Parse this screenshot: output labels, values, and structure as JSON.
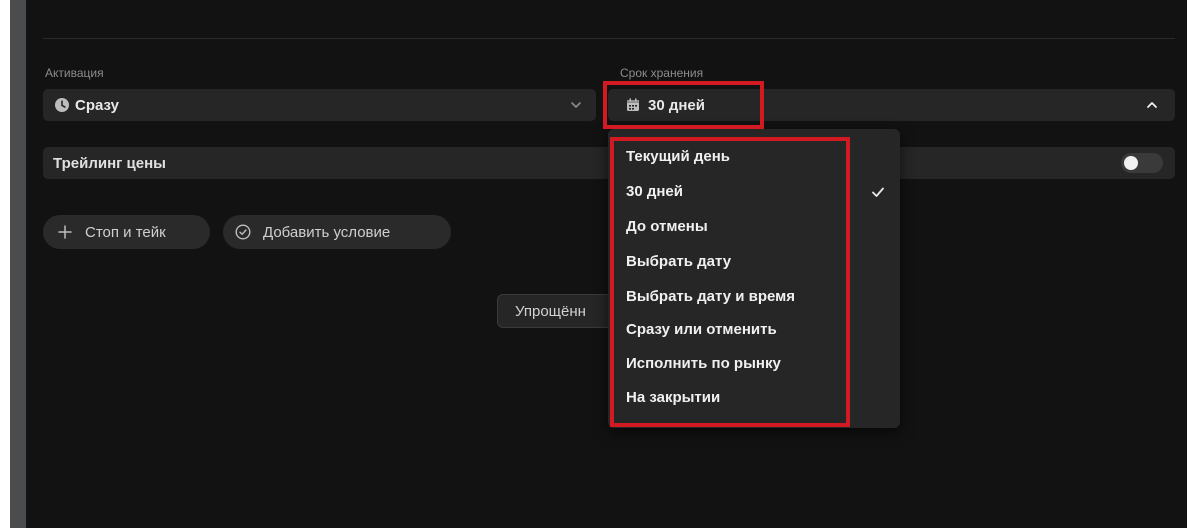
{
  "activation": {
    "label": "Активация",
    "value": "Сразу",
    "icon": "clock-icon"
  },
  "expiry": {
    "label": "Срок хранения",
    "value": "30 дней",
    "icon": "calendar-icon"
  },
  "trailing": {
    "label": "Трейлинг цены",
    "enabled": false
  },
  "actions": {
    "stop_take_label": "Стоп и тейк",
    "add_condition_label": "Добавить условие"
  },
  "mode_button": {
    "label": "Упрощённ"
  },
  "expiry_options": [
    {
      "label": "Текущий день",
      "selected": false
    },
    {
      "label": "30 дней",
      "selected": true
    },
    {
      "label": "До отмены",
      "selected": false
    },
    {
      "label": "Выбрать дату",
      "selected": false
    },
    {
      "label": "Выбрать дату и время",
      "selected": false
    },
    {
      "label": "Сразу или отменить",
      "selected": false
    },
    {
      "label": "Исполнить по рынку",
      "selected": false
    },
    {
      "label": "На закрытии",
      "selected": false
    }
  ],
  "colors": {
    "panel_bg": "#121212",
    "control_bg": "#262626",
    "highlight": "#d21a22"
  }
}
